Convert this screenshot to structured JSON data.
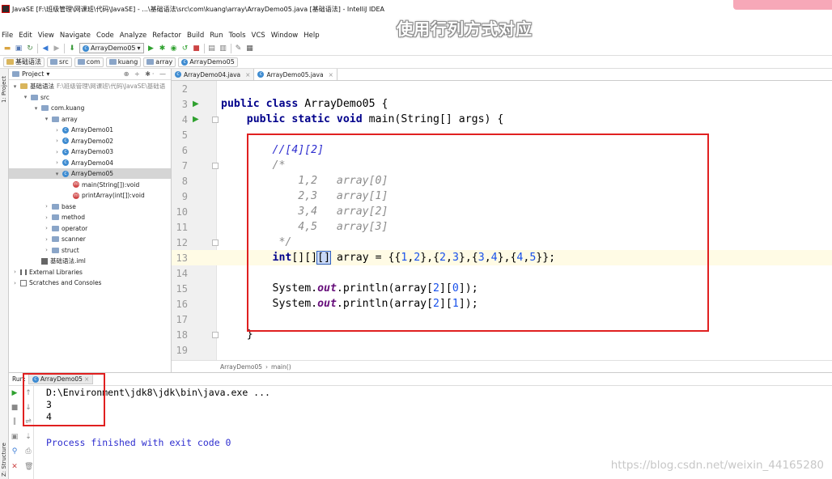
{
  "window": {
    "title": "JavaSE [F:\\班级管理\\网课班\\代码\\JavaSE] - ...\\基础语法\\src\\com\\kuang\\array\\ArrayDemo05.java [基础语法] - IntelliJ IDEA",
    "overlay_caption": "使用行列方式对应"
  },
  "menu": [
    "File",
    "Edit",
    "View",
    "Navigate",
    "Code",
    "Analyze",
    "Refactor",
    "Build",
    "Run",
    "Tools",
    "VCS",
    "Window",
    "Help"
  ],
  "toolbar": {
    "run_config": "ArrayDemo05"
  },
  "navbar": [
    "基础语法",
    "src",
    "com",
    "kuang",
    "array",
    "ArrayDemo05"
  ],
  "project_panel": {
    "header": "Project",
    "tree": [
      {
        "label": "基础语法",
        "suffix": "F:\\班级管理\\网课班\\代码\\JavaSE\\基础语",
        "type": "module",
        "depth": 0,
        "arrow": "▾"
      },
      {
        "label": "src",
        "type": "folder",
        "depth": 1,
        "arrow": "▾"
      },
      {
        "label": "com.kuang",
        "type": "package",
        "depth": 2,
        "arrow": "▾"
      },
      {
        "label": "array",
        "type": "package",
        "depth": 3,
        "arrow": "▾"
      },
      {
        "label": "ArrayDemo01",
        "type": "class",
        "depth": 4,
        "arrow": "›"
      },
      {
        "label": "ArrayDemo02",
        "type": "class",
        "depth": 4,
        "arrow": "›"
      },
      {
        "label": "ArrayDemo03",
        "type": "class",
        "depth": 4,
        "arrow": "›"
      },
      {
        "label": "ArrayDemo04",
        "type": "class",
        "depth": 4,
        "arrow": "›"
      },
      {
        "label": "ArrayDemo05",
        "type": "class",
        "depth": 4,
        "arrow": "▾",
        "selected": true
      },
      {
        "label": "main(String[]):void",
        "type": "method",
        "depth": 5,
        "arrow": ""
      },
      {
        "label": "printArray(int[]):void",
        "type": "method",
        "depth": 5,
        "arrow": ""
      },
      {
        "label": "base",
        "type": "package",
        "depth": 3,
        "arrow": "›"
      },
      {
        "label": "method",
        "type": "package",
        "depth": 3,
        "arrow": "›"
      },
      {
        "label": "operator",
        "type": "package",
        "depth": 3,
        "arrow": "›"
      },
      {
        "label": "scanner",
        "type": "package",
        "depth": 3,
        "arrow": "›"
      },
      {
        "label": "struct",
        "type": "package",
        "depth": 3,
        "arrow": "›"
      },
      {
        "label": "基础语法.iml",
        "type": "iml",
        "depth": 2,
        "arrow": ""
      },
      {
        "label": "External Libraries",
        "type": "lib",
        "depth": 0,
        "arrow": "›"
      },
      {
        "label": "Scratches and Consoles",
        "type": "scratch",
        "depth": 0,
        "arrow": "›"
      }
    ]
  },
  "tabs": [
    {
      "label": "ArrayDemo04.java",
      "active": false
    },
    {
      "label": "ArrayDemo05.java",
      "active": true
    }
  ],
  "editor": {
    "line_numbers": [
      "2",
      "3",
      "4",
      "5",
      "6",
      "7",
      "8",
      "9",
      "10",
      "11",
      "12",
      "13",
      "14",
      "15",
      "16",
      "17",
      "18",
      "19"
    ],
    "current_line": "13",
    "breadcrumb": [
      "ArrayDemo05",
      "main()"
    ]
  },
  "run_panel": {
    "label": "Run:",
    "tab": "ArrayDemo05",
    "console": [
      "D:\\Environment\\jdk8\\jdk\\bin\\java.exe ...",
      "3",
      "4",
      "",
      "Process finished with exit code 0"
    ]
  },
  "sidebar_labels": {
    "project": "1: Project",
    "structure": "Z: Structure"
  },
  "watermark": "https://blog.csdn.net/weixin_44165280"
}
